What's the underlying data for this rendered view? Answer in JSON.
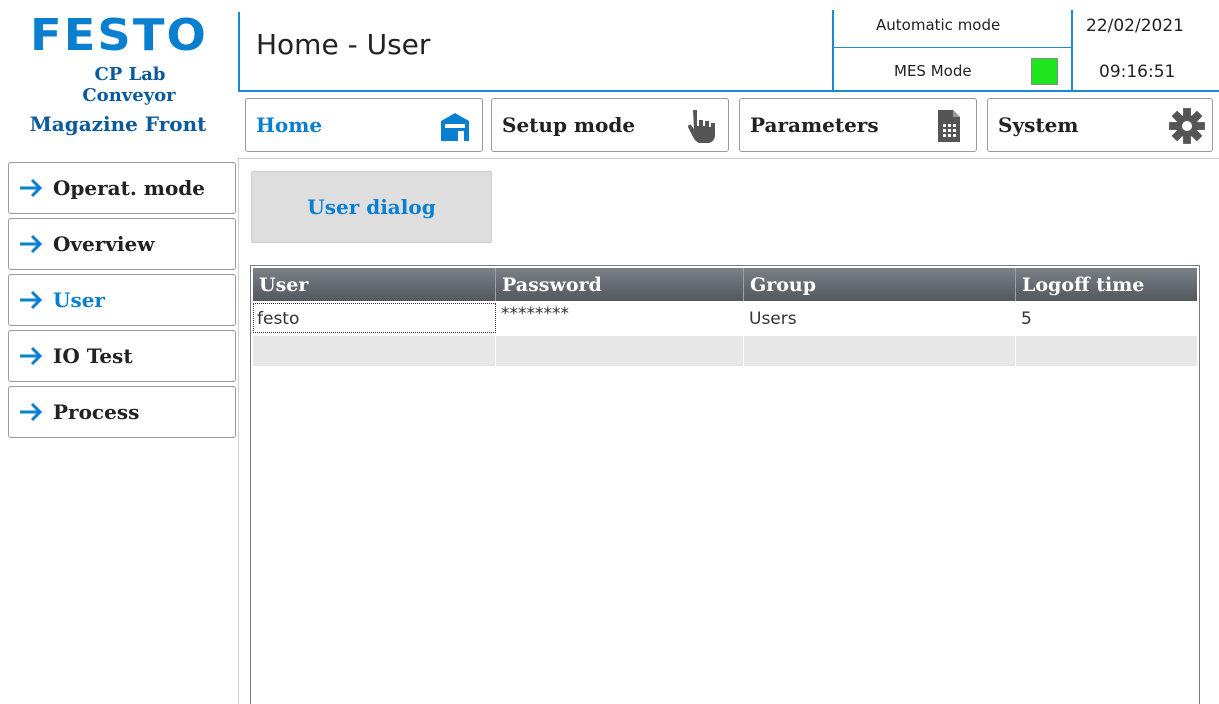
{
  "brand": {
    "logo_text": "FESTO",
    "station_line1": "CP Lab",
    "station_line2": "Conveyor",
    "station_line3": "Magazine Front",
    "color": "#0a7fd0"
  },
  "header": {
    "title": "Home - User",
    "mode_label": "Automatic mode",
    "mes_label": "MES Mode",
    "mes_status_color": "#1ee61e",
    "date": "22/02/2021",
    "time": "09:16:51"
  },
  "topnav": [
    {
      "label": "Home",
      "icon": "home-icon",
      "active": true
    },
    {
      "label": "Setup mode",
      "icon": "hand-pointer-icon",
      "active": false
    },
    {
      "label": "Parameters",
      "icon": "document-table-icon",
      "active": false
    },
    {
      "label": "System",
      "icon": "gear-icon",
      "active": false
    }
  ],
  "sidebar": {
    "items": [
      {
        "label": "Operat. mode",
        "icon": "arrow-right-icon"
      },
      {
        "label": "Overview",
        "icon": "arrow-right-icon"
      },
      {
        "label": "User",
        "icon": "arrow-right-icon"
      },
      {
        "label": "IO Test",
        "icon": "arrow-right-icon"
      },
      {
        "label": "Process",
        "icon": "arrow-right-icon"
      }
    ]
  },
  "main": {
    "user_dialog_label": "User dialog",
    "table": {
      "columns": [
        "User",
        "Password",
        "Group",
        "Logoff time"
      ],
      "rows": [
        [
          "festo",
          "********",
          "Users",
          "5"
        ],
        [
          "",
          "",
          "",
          ""
        ]
      ]
    }
  }
}
